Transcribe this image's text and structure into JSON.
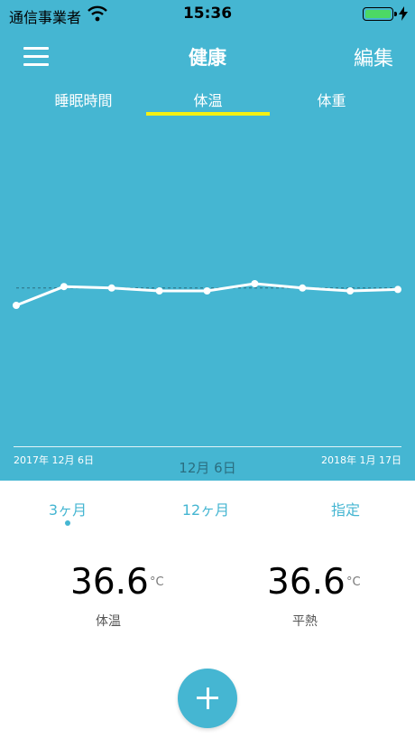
{
  "status_bar": {
    "carrier": "通信事業者",
    "time": "15:36"
  },
  "nav": {
    "title": "健康",
    "edit_label": "編集"
  },
  "tabs": [
    {
      "label": "睡眠時間"
    },
    {
      "label": "体温"
    },
    {
      "label": "体重"
    }
  ],
  "chart_data": {
    "type": "line",
    "x": [
      "2017-12-06",
      "2017-12-11",
      "2017-12-16",
      "2017-12-21",
      "2017-12-26",
      "2017-12-31",
      "2018-01-05",
      "2018-01-11",
      "2018-01-17"
    ],
    "values": [
      36.0,
      36.65,
      36.6,
      36.5,
      36.5,
      36.75,
      36.6,
      36.5,
      36.55
    ],
    "average": 36.6,
    "ylim": [
      35.0,
      37.5
    ],
    "start_label": "2017年 12月 6日",
    "end_label": "2018年 1月 17日",
    "selected_label": "12月 6日",
    "colors": {
      "line": "#ffffff",
      "average": "#2B6E80",
      "background": "#45B6D2"
    }
  },
  "range_options": [
    {
      "label": "3ヶ月"
    },
    {
      "label": "12ヶ月"
    },
    {
      "label": "指定"
    }
  ],
  "stats": [
    {
      "value": "36.6",
      "unit": "°C",
      "label": "体温"
    },
    {
      "value": "36.6",
      "unit": "°C",
      "label": "平熱"
    }
  ],
  "accent_color": "#45B6D2"
}
